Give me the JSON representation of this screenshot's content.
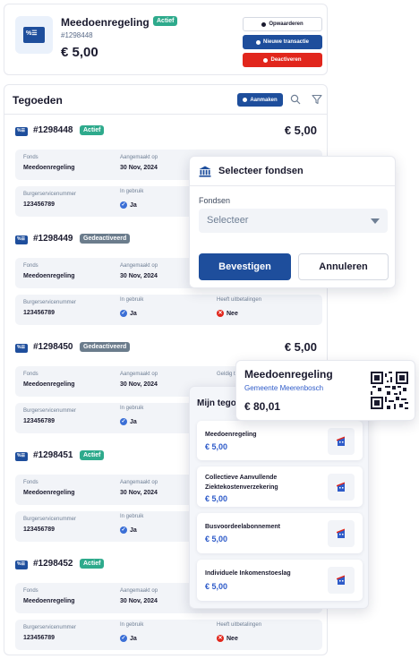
{
  "top_card": {
    "title": "Meedoenregeling",
    "status": "Actief",
    "number": "#1298448",
    "amount": "€ 5,00",
    "buttons": {
      "topup": "Opwaarderen",
      "new_transaction": "Nieuwe transactie",
      "deactivate": "Deactiveren"
    }
  },
  "main": {
    "heading": "Tegoeden",
    "add_label": "Aanmaken",
    "entries": [
      {
        "id": "#1298448",
        "status": "Actief",
        "amount": "€ 5,00",
        "fund_label": "Fonds",
        "fund": "Meedoenregeling",
        "created_label": "Aangemaakt op",
        "created": "30 Nov, 2024",
        "bsn_label": "Burgerservicenummer",
        "bsn": "123456789",
        "in_use_label": "In gebruik",
        "in_use": "Ja"
      },
      {
        "id": "#1298449",
        "status": "Gedeactiveerd",
        "amount": "",
        "fund_label": "Fonds",
        "fund": "Meedoenregeling",
        "created_label": "Aangemaakt op",
        "created": "30 Nov, 2024",
        "bsn_label": "Burgerservicenummer",
        "bsn": "123456789",
        "in_use_label": "In gebruik",
        "in_use": "Ja",
        "payouts_label": "Heeft uitbetalingen",
        "payouts": "Nee"
      },
      {
        "id": "#1298450",
        "status": "Gedeactiveerd",
        "amount": "€ 5,00",
        "fund_label": "Fonds",
        "fund": "Meedoenregeling",
        "created_label": "Aangemaakt op",
        "created": "30 Nov, 2024",
        "valid_label": "Geldig t",
        "bsn_label": "Burgerservicenummer",
        "bsn": "123456789",
        "in_use_label": "In gebruik",
        "in_use": "Ja"
      },
      {
        "id": "#1298451",
        "status": "Actief",
        "amount": "",
        "fund_label": "Fonds",
        "fund": "Meedoenregeling",
        "created_label": "Aangemaakt op",
        "created": "30 Nov, 2024",
        "bsn_label": "Burgerservicenummer",
        "bsn": "123456789",
        "in_use_label": "In gebruik",
        "in_use": "Ja"
      },
      {
        "id": "#1298452",
        "status": "Actief",
        "amount": "",
        "fund_label": "Fonds",
        "fund": "Meedoenregeling",
        "created_label": "Aangemaakt op",
        "created": "30 Nov, 2024",
        "bsn_label": "Burgerservicenummer",
        "bsn": "123456789",
        "in_use_label": "In gebruik",
        "in_use": "Ja",
        "payouts_label": "Heeft uitbetalingen",
        "payouts": "Nee"
      }
    ]
  },
  "modal": {
    "title": "Selecteer fondsen",
    "field_label": "Fondsen",
    "select_placeholder": "Selecteer",
    "confirm": "Bevestigen",
    "cancel": "Annuleren"
  },
  "mine": {
    "heading": "Mijn tego",
    "items": [
      {
        "name": "Meedoenregeling",
        "amount": "€ 5,00"
      },
      {
        "name": "Collectieve Aanvullende Ziektekostenverzekering",
        "amount": "€ 5,00"
      },
      {
        "name": "Busvoordeelabonnement",
        "amount": "€ 5,00"
      },
      {
        "name": "Individuele Inkomenstoeslag",
        "amount": "€ 5,00"
      }
    ]
  },
  "pass": {
    "title": "Meedoenregeling",
    "subtitle": "Gemeente Meerenbosch",
    "amount": "€ 80,01"
  },
  "colors": {
    "primary": "#1e4e9c",
    "danger": "#e1261c",
    "success": "#2eaa8c",
    "muted_badge": "#6b7c8c",
    "link": "#2e5bc9"
  }
}
